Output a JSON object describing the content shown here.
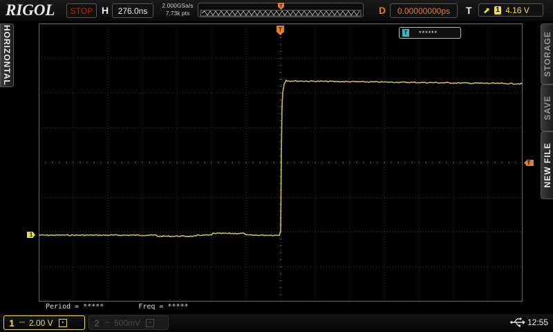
{
  "header": {
    "brand": "RIGOL",
    "run_status": "STOP",
    "horizontal_label": "H",
    "horizontal_value": "276.0ns",
    "sample_rate": "2.000GSa/s",
    "memory_depth": "7.73k pts",
    "delay_label": "D",
    "delay_value": "0.00000000ps",
    "trigger_label": "T",
    "trigger_source": "1",
    "trigger_level": "4.16 V"
  },
  "side_tabs": {
    "left": "HORIZONTAL",
    "right": [
      "STORAGE",
      "SAVE",
      "NEW FILE"
    ]
  },
  "screen": {
    "ch1_marker": "1",
    "trigger_marker": "T",
    "cursor_icon": "T",
    "cursor_value": "******"
  },
  "measurements": [
    {
      "label": "Period = *****"
    },
    {
      "label": "Freq = *****"
    }
  ],
  "channels": [
    {
      "num": "1",
      "coupling": "⎓",
      "scale": "2.00 V",
      "active": true
    },
    {
      "num": "2",
      "coupling": "⎓",
      "scale": "500mV",
      "active": false
    }
  ],
  "status": {
    "clock": "12:55",
    "usb_icon": "usb-icon"
  },
  "colors": {
    "ch1": "#e8e040",
    "trigger": "#e07f28",
    "stop": "#d21a1a",
    "grid": "#3a3a3a",
    "cursor": "#3ab5c6"
  }
}
